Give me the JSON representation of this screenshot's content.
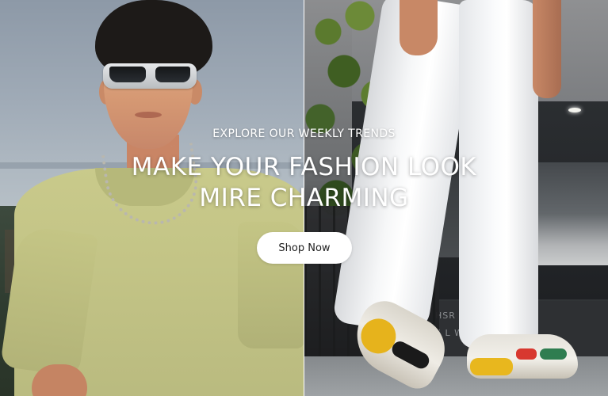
{
  "hero": {
    "eyebrow": "EXPLORE OUR WEEKLY TRENDS",
    "headline_line1": "MAKE YOUR FASHION LOOK",
    "headline_line2": "MIRE CHARMING",
    "cta_label": "Shop Now"
  },
  "background_sign": {
    "line1": "HSR  -SPACE MOD",
    "line2": "S L  WORKING SPA"
  },
  "colors": {
    "text": "#ffffff",
    "button_bg": "#ffffff",
    "button_text": "#1e1e1e",
    "shirt": "#c3c486",
    "pants": "#f6f7f8"
  }
}
